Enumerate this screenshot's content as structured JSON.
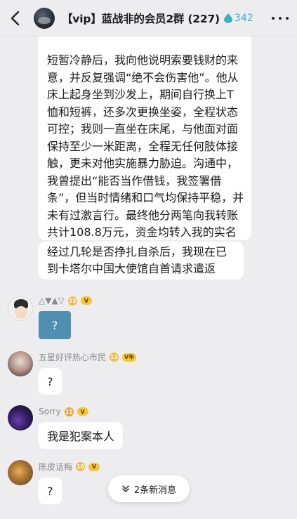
{
  "header": {
    "title": "【vip】蓝战非的会员2群 (227)",
    "heat_count": "342",
    "icons": {
      "back": "chevron-left-icon",
      "heat": "droplet-icon",
      "more": "more-icon"
    }
  },
  "messages": {
    "long_text": "短暂冷静后，我向他说明索要钱财的来意，并反复强调“绝不会伤害他”。他从床上起身坐到沙发上，期间自行换上T恤和短裤，还多次更换坐姿，全程状态可控；我则一直坐在床尾，与他面对面保持至少一米距离，全程无任何肢体接触，更未对他实施暴力胁迫。沟通中，我曾提出“能否当作借钱，我签署借条”，但当时情绪和口气均保持平稳，并未有过激言行。最终他分两笔向我转账共计108.8万元，资金均转入我的实名国内账",
    "mid_text": "经过几轮是否挣扎自杀后，我现在已到卡塔尔中国大使馆自首请求遣返",
    "list": [
      {
        "sender": "△▼▲▽",
        "level": "12",
        "badge": "V",
        "content": "?"
      },
      {
        "sender": "五星好评热心市民",
        "level": "13",
        "badge": "V年",
        "content": "?"
      },
      {
        "sender": "Sorry",
        "level": "11",
        "badge": "V",
        "content": "我是犯案本人"
      },
      {
        "sender": "陈皮话梅",
        "level": "10",
        "badge": "V",
        "content": "?"
      }
    ]
  },
  "new_messages": {
    "label": "2条新消息",
    "icon": "double-chevron-down-icon"
  },
  "colors": {
    "background": "#ededf0",
    "accent": "#3ab0c8",
    "image_bubble": "#4f8fb0"
  }
}
